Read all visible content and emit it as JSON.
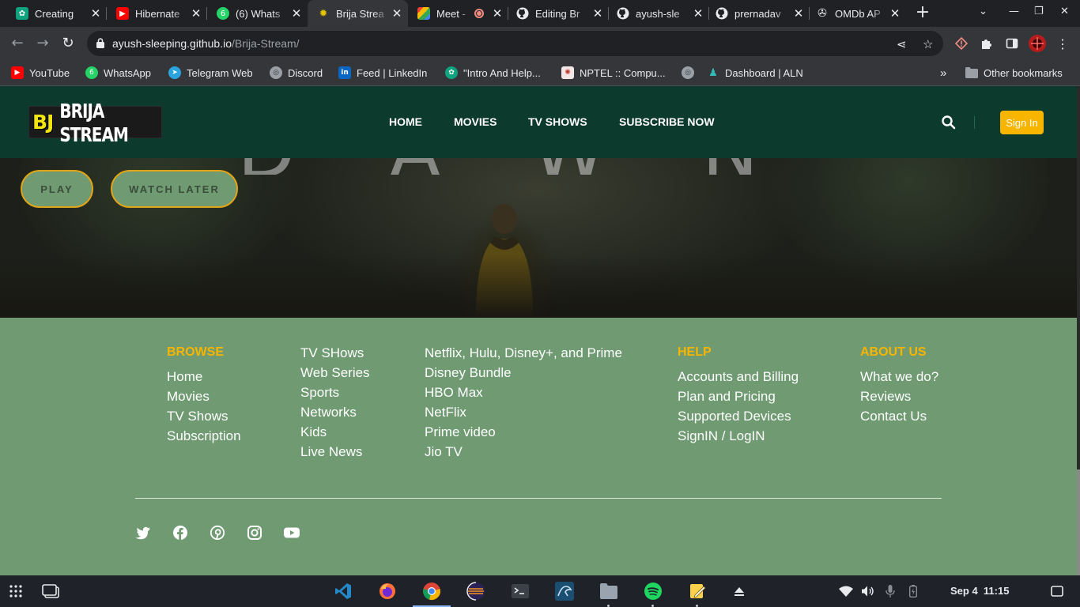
{
  "browser": {
    "tabs": [
      {
        "title": "Creating",
        "favicon": "chatgpt-icon",
        "color": "#10a37f",
        "active": false
      },
      {
        "title": "Hibernate",
        "favicon": "youtube-icon",
        "color": "#ff0000",
        "active": false
      },
      {
        "title": "(6) Whats",
        "favicon": "whatsapp-icon",
        "color": "#25d366",
        "active": false
      },
      {
        "title": "Brija Strea",
        "favicon": "brija-icon",
        "color": "#e2c400",
        "active": true
      },
      {
        "title": "Meet -",
        "favicon": "google-meet-icon",
        "color": "#00832d",
        "active": false
      },
      {
        "title": "Editing Br",
        "favicon": "github-icon",
        "color": "#e8eaed",
        "active": false
      },
      {
        "title": "ayush-sle",
        "favicon": "github-icon",
        "color": "#e8eaed",
        "active": false
      },
      {
        "title": "prernadav",
        "favicon": "github-icon",
        "color": "#e8eaed",
        "active": false
      },
      {
        "title": "OMDb AP",
        "favicon": "omdb-icon",
        "color": "#e8eaed",
        "active": false
      }
    ],
    "whatsapp_badge": "6",
    "url_host": "ayush-sleeping.github.io",
    "url_path": "/Brija-Stream/",
    "bookmarks": [
      {
        "label": "YouTube",
        "icon": "youtube-icon",
        "color": "#ff0000"
      },
      {
        "label": "WhatsApp",
        "icon": "whatsapp-icon",
        "color": "#25d366"
      },
      {
        "label": "Telegram Web",
        "icon": "telegram-icon",
        "color": "#2aa3df"
      },
      {
        "label": "Discord",
        "icon": "globe-icon",
        "color": "#9aa0a6"
      },
      {
        "label": "Feed | LinkedIn",
        "icon": "linkedin-icon",
        "color": "#0a66c2"
      },
      {
        "label": "\"Intro And Help...",
        "icon": "chatgpt-icon",
        "color": "#10a37f"
      },
      {
        "label": "NPTEL :: Compu...",
        "icon": "nptel-icon",
        "color": "#d44"
      },
      {
        "label": "",
        "icon": "globe-icon",
        "color": "#9aa0a6"
      },
      {
        "label": "Dashboard | ALN",
        "icon": "aln-icon",
        "color": "#3bb"
      }
    ],
    "other_bookmarks": "Other bookmarks"
  },
  "site": {
    "logo_initials": "BJ",
    "logo_name": "BRIJA STREAM",
    "nav": [
      "HOME",
      "MOVIES",
      "TV SHOWS",
      "SUBSCRIBE NOW"
    ],
    "signin_label": "Sign In",
    "hero_letters": "DAWN",
    "play_label": "PLAY",
    "watch_later_label": "WATCH LATER",
    "footer": {
      "browse": {
        "heading": "BROWSE",
        "links": [
          "Home",
          "Movies",
          "TV Shows",
          "Subscription"
        ]
      },
      "col2": {
        "links": [
          "TV SHows",
          "Web Series",
          "Sports",
          "Networks",
          "Kids",
          "Live News"
        ]
      },
      "col3": {
        "links": [
          "Netflix, Hulu, Disney+, and Prime",
          "Disney Bundle",
          "HBO Max",
          "NetFlix",
          "Prime video",
          "Jio TV"
        ]
      },
      "help": {
        "heading": "HELP",
        "links": [
          "Accounts and Billing",
          "Plan and Pricing",
          "Supported Devices",
          "SignIN / LogIN"
        ]
      },
      "about": {
        "heading": "ABOUT US",
        "links": [
          "What we do?",
          "Reviews",
          "Contact Us"
        ]
      }
    },
    "social": [
      "twitter-icon",
      "facebook-icon",
      "pinterest-icon",
      "instagram-icon",
      "youtube-icon"
    ],
    "colors": {
      "header": "#0c3a2c",
      "footer": "#6f9a72",
      "accent": "#f7b500"
    }
  },
  "os": {
    "date": "Sep 4",
    "time": "11:15",
    "shelf_apps": [
      "vscode-icon",
      "firefox-icon",
      "chrome-icon",
      "eclipse-icon",
      "terminal-icon",
      "mysql-workbench-icon",
      "files-icon",
      "spotify-icon",
      "text-editor-icon"
    ]
  }
}
